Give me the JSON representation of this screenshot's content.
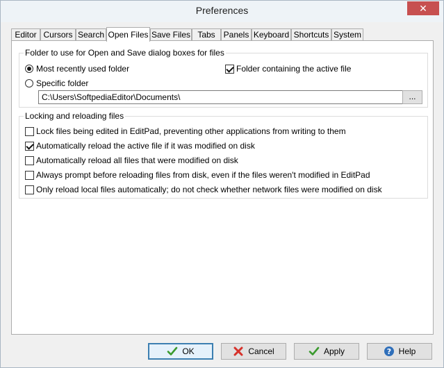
{
  "window": {
    "title": "Preferences",
    "close_glyph": "✕"
  },
  "tabs": [
    {
      "label": "Editor"
    },
    {
      "label": "Cursors"
    },
    {
      "label": "Search"
    },
    {
      "label": "Open Files",
      "active": true
    },
    {
      "label": "Save Files"
    },
    {
      "label": "Tabs"
    },
    {
      "label": "Panels"
    },
    {
      "label": "Keyboard"
    },
    {
      "label": "Shortcuts"
    },
    {
      "label": "System"
    }
  ],
  "folder_group": {
    "title": "Folder to use for Open and Save dialog boxes for files",
    "option_recent": "Most recently used folder",
    "option_recent_selected": true,
    "option_specific": "Specific folder",
    "option_specific_selected": false,
    "folder_path": "C:\\Users\\SoftpediaEditor\\Documents\\",
    "browse_label": "...",
    "active_file_label": "Folder containing the active file",
    "active_file_checked": true
  },
  "locking_group": {
    "title": "Locking and reloading files",
    "options": [
      {
        "label": "Lock files being edited in EditPad, preventing other applications from writing to them",
        "checked": false
      },
      {
        "label": "Automatically reload the active file if it was modified on disk",
        "checked": true
      },
      {
        "label": "Automatically reload all files that were modified on disk",
        "checked": false
      },
      {
        "label": "Always prompt before reloading files from disk, even if the files weren't modified in EditPad",
        "checked": false
      },
      {
        "label": "Only reload local files automatically; do not check whether network files were modified on disk",
        "checked": false
      }
    ]
  },
  "buttons": {
    "ok": "OK",
    "cancel": "Cancel",
    "apply": "Apply",
    "help": "Help"
  },
  "icons": {
    "ok": "check-icon",
    "cancel": "cross-icon",
    "apply": "check-icon",
    "help": "help-icon"
  },
  "colors": {
    "check_green": "#3a9a2e",
    "cancel_red": "#d6312a",
    "help_blue": "#2f6fba",
    "default_button_border": "#3c7fb1"
  }
}
